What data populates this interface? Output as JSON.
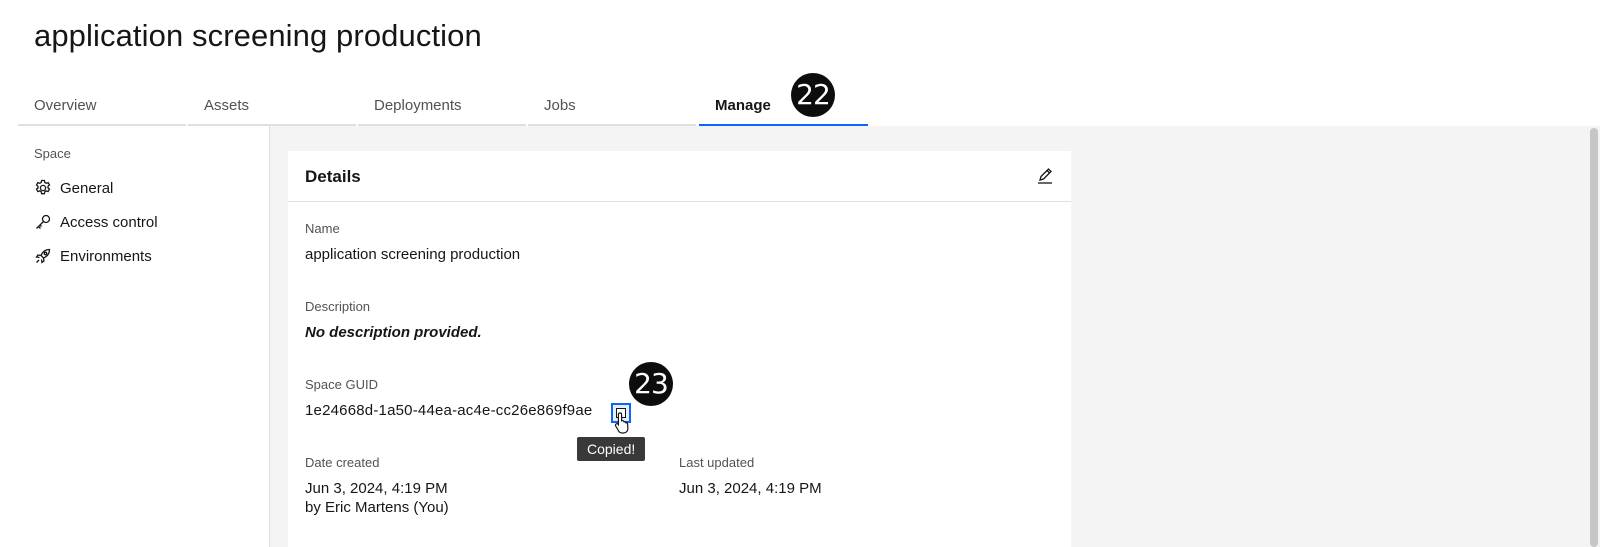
{
  "page": {
    "title": "application screening production"
  },
  "tabs": [
    {
      "label": "Overview",
      "active": false
    },
    {
      "label": "Assets",
      "active": false
    },
    {
      "label": "Deployments",
      "active": false
    },
    {
      "label": "Jobs",
      "active": false
    },
    {
      "label": "Manage",
      "active": true
    }
  ],
  "badges": {
    "tab_badge": "22",
    "copy_badge": "23"
  },
  "sidebar": {
    "heading": "Space",
    "items": [
      {
        "label": "General",
        "icon": "gear-icon"
      },
      {
        "label": "Access control",
        "icon": "key-icon"
      },
      {
        "label": "Environments",
        "icon": "rocket-icon"
      }
    ]
  },
  "details": {
    "title": "Details",
    "edit_icon": "edit-pencil-icon",
    "name_label": "Name",
    "name_value": "application screening production",
    "description_label": "Description",
    "description_value": "No description provided.",
    "guid_label": "Space GUID",
    "guid_value": "1e24668d-1a50-44ea-ac4e-cc26e869f9ae",
    "copy_tooltip": "Copied!",
    "date_created_label": "Date created",
    "date_created_value": "Jun 3, 2024, 4:19 PM",
    "created_by": "by Eric Martens (You)",
    "last_updated_label": "Last updated",
    "last_updated_value": "Jun 3, 2024, 4:19 PM"
  },
  "colors": {
    "accent": "#0f62fe",
    "badge": "#0d0d0d",
    "tooltip": "#393939",
    "content_bg": "#f4f4f4"
  }
}
